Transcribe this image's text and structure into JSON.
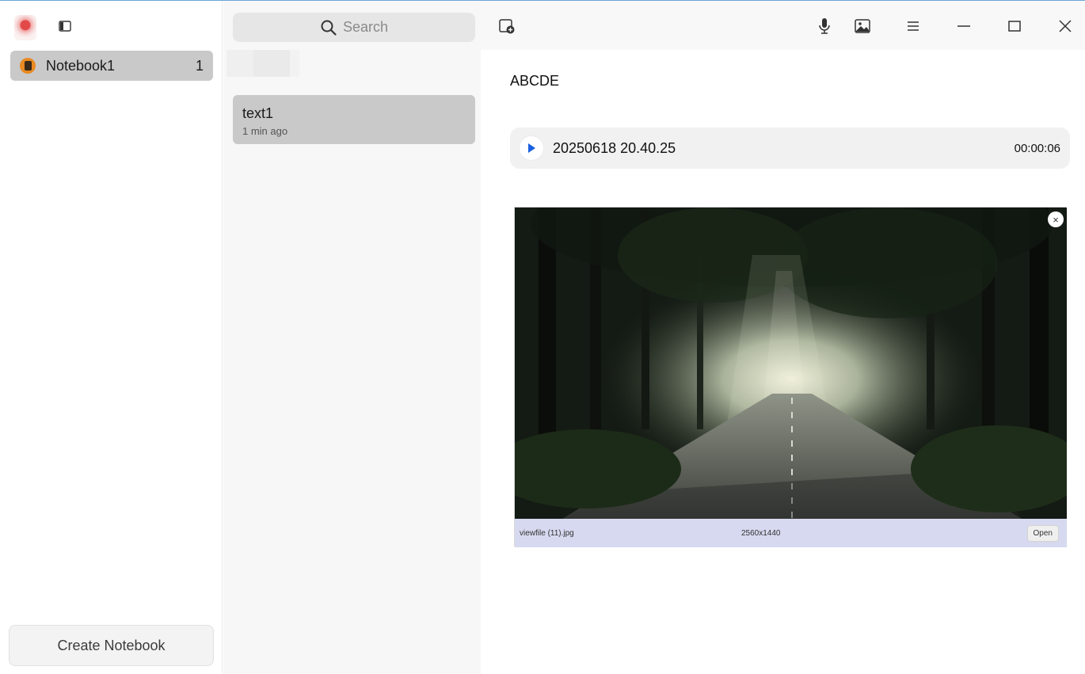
{
  "sidebar": {
    "notebooks": [
      {
        "name": "Notebook1",
        "count": "1"
      }
    ],
    "create_label": "Create Notebook"
  },
  "notelist": {
    "search_placeholder": "Search",
    "notes": [
      {
        "title": "text1",
        "time": "1 min ago"
      }
    ]
  },
  "editor": {
    "text": "ABCDE",
    "audio": {
      "name": "20250618 20.40.25",
      "duration": "00:00:06"
    },
    "image": {
      "filename": "viewfile (11).jpg",
      "dimensions": "2560x1440",
      "open_label": "Open"
    }
  },
  "colors": {
    "selected_bg": "#c9c9c9",
    "play_accent": "#1a5fe0",
    "image_footer": "#d6d9ef"
  },
  "icons": [
    "app-logo",
    "sidebar-toggle-icon",
    "search-icon",
    "new-note-icon",
    "microphone-icon",
    "image-icon",
    "menu-icon",
    "minimize-icon",
    "maximize-icon",
    "close-icon",
    "play-icon",
    "notebook-icon"
  ]
}
